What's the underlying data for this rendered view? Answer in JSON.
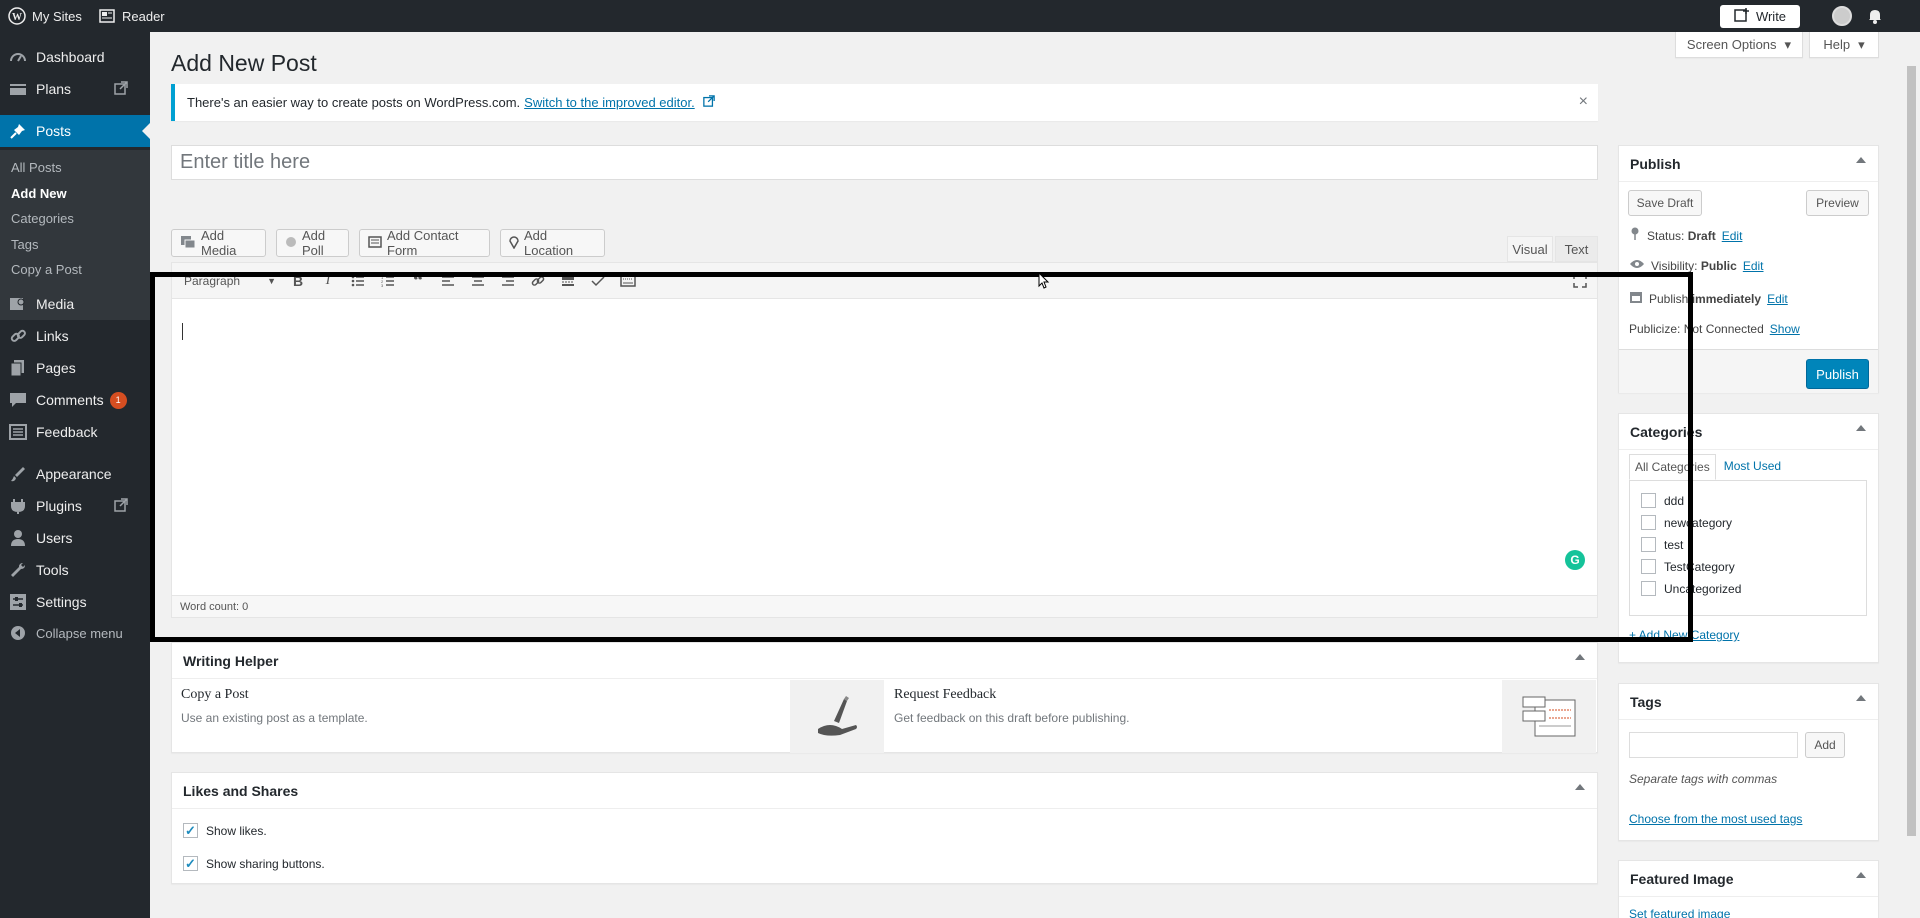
{
  "adminbar": {
    "my_sites": "My Sites",
    "reader": "Reader",
    "write": "Write"
  },
  "sidebar": {
    "items": [
      {
        "label": "Dashboard",
        "icon": "dashboard-icon"
      },
      {
        "label": "Plans",
        "icon": "plans-icon"
      },
      {
        "label": "Posts",
        "icon": "pin-icon"
      },
      {
        "label": "Media",
        "icon": "media-icon"
      },
      {
        "label": "Links",
        "icon": "links-icon"
      },
      {
        "label": "Pages",
        "icon": "pages-icon"
      },
      {
        "label": "Comments",
        "icon": "comments-icon",
        "badge": "1"
      },
      {
        "label": "Feedback",
        "icon": "feedback-icon"
      },
      {
        "label": "Appearance",
        "icon": "appearance-icon"
      },
      {
        "label": "Plugins",
        "icon": "plugins-icon"
      },
      {
        "label": "Users",
        "icon": "users-icon"
      },
      {
        "label": "Tools",
        "icon": "tools-icon"
      },
      {
        "label": "Settings",
        "icon": "settings-icon"
      },
      {
        "label": "Collapse menu",
        "icon": "collapse-icon"
      }
    ],
    "submenu": [
      "All Posts",
      "Add New",
      "Categories",
      "Tags",
      "Copy a Post"
    ]
  },
  "header": {
    "title": "Add New Post",
    "screen_options": "Screen Options",
    "help": "Help"
  },
  "notice": {
    "text": "There's an easier way to create posts on WordPress.com.",
    "link": "Switch to the improved editor."
  },
  "editor": {
    "title_placeholder": "Enter title here",
    "media_buttons": [
      "Add Media",
      "Add Poll",
      "Add Contact Form",
      "Add Location"
    ],
    "tabs": {
      "visual": "Visual",
      "text": "Text"
    },
    "format": "Paragraph",
    "word_count": "Word count: 0",
    "grammarly": "G"
  },
  "writing_helper": {
    "title": "Writing Helper",
    "copy_title": "Copy a Post",
    "copy_desc": "Use an existing post as a template.",
    "feedback_title": "Request Feedback",
    "feedback_desc": "Get feedback on this draft before publishing."
  },
  "likes": {
    "title": "Likes and Shares",
    "show_likes": "Show likes.",
    "show_sharing": "Show sharing buttons."
  },
  "publish": {
    "title": "Publish",
    "save_draft": "Save Draft",
    "preview": "Preview",
    "status_label": "Status:",
    "status_value": "Draft",
    "visibility_label": "Visibility:",
    "visibility_value": "Public",
    "publish_label": "Publish",
    "publish_value": "immediately",
    "publicize_label": "Publicize:",
    "publicize_value": "Not Connected",
    "edit": "Edit",
    "show": "Show",
    "publish_button": "Publish"
  },
  "categories": {
    "title": "Categories",
    "tab_all": "All Categories",
    "tab_most": "Most Used",
    "items": [
      "ddd",
      "newcategory",
      "test",
      "TestCategory",
      "Uncategorized"
    ],
    "add_new": "+ Add New Category"
  },
  "tags": {
    "title": "Tags",
    "add": "Add",
    "hint": "Separate tags with commas",
    "choose": "Choose from the most used tags"
  },
  "featured": {
    "title": "Featured Image",
    "set": "Set featured image"
  },
  "colors": {
    "accent": "#0073aa",
    "admin_bg": "#23282d",
    "notice_border": "#00a0d2"
  }
}
